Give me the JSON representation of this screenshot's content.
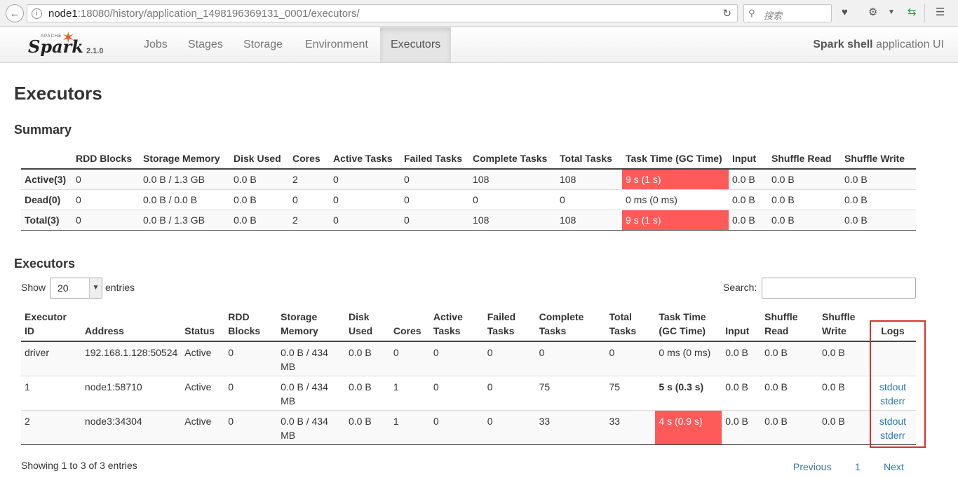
{
  "browser": {
    "url_host": "node1",
    "url_rest": ":18080/history/application_1498196369131_0001/executors/",
    "search_placeholder": "搜索"
  },
  "nav": {
    "brand_apache": "APACHE",
    "brand_spark": "Spark",
    "version": "2.1.0",
    "tabs": [
      "Jobs",
      "Stages",
      "Storage",
      "Environment",
      "Executors"
    ],
    "active_tab": "Executors",
    "app_title_bold": "Spark shell",
    "app_title_rest": " application UI"
  },
  "page_title": "Executors",
  "summary": {
    "heading": "Summary",
    "headers": [
      "",
      "RDD Blocks",
      "Storage Memory",
      "Disk Used",
      "Cores",
      "Active Tasks",
      "Failed Tasks",
      "Complete Tasks",
      "Total Tasks",
      "Task Time (GC Time)",
      "Input",
      "Shuffle Read",
      "Shuffle Write"
    ],
    "rows": [
      [
        "Active(3)",
        "0",
        "0.0 B / 1.3 GB",
        "0.0 B",
        "2",
        "0",
        "0",
        "108",
        "108",
        "9 s (1 s)",
        "0.0 B",
        "0.0 B",
        "0.0 B"
      ],
      [
        "Dead(0)",
        "0",
        "0.0 B / 0.0 B",
        "0.0 B",
        "0",
        "0",
        "0",
        "0",
        "0",
        "0 ms (0 ms)",
        "0.0 B",
        "0.0 B",
        "0.0 B"
      ],
      [
        "Total(3)",
        "0",
        "0.0 B / 1.3 GB",
        "0.0 B",
        "2",
        "0",
        "0",
        "108",
        "108",
        "9 s (1 s)",
        "0.0 B",
        "0.0 B",
        "0.0 B"
      ]
    ]
  },
  "executors": {
    "heading": "Executors",
    "show_label": "Show",
    "page_size": "20",
    "entries_label": "entries",
    "search_label": "Search:",
    "headers": [
      "Executor ID",
      "Address",
      "Status",
      "RDD Blocks",
      "Storage Memory",
      "Disk Used",
      "Cores",
      "Active Tasks",
      "Failed Tasks",
      "Complete Tasks",
      "Total Tasks",
      "Task Time (GC Time)",
      "Input",
      "Shuffle Read",
      "Shuffle Write",
      "Logs"
    ],
    "rows": [
      [
        "driver",
        "192.168.1.128:50524",
        "Active",
        "0",
        "0.0 B / 434 MB",
        "0.0 B",
        "0",
        "0",
        "0",
        "0",
        "0",
        "0 ms (0 ms)",
        "0.0 B",
        "0.0 B",
        "0.0 B"
      ],
      [
        "1",
        "node1:58710",
        "Active",
        "0",
        "0.0 B / 434 MB",
        "0.0 B",
        "1",
        "0",
        "0",
        "75",
        "75",
        "5 s (0.3 s)",
        "0.0 B",
        "0.0 B",
        "0.0 B"
      ],
      [
        "2",
        "node3:34304",
        "Active",
        "0",
        "0.0 B / 434 MB",
        "0.0 B",
        "1",
        "0",
        "0",
        "33",
        "33",
        "4 s (0.9 s)",
        "0.0 B",
        "0.0 B",
        "0.0 B"
      ]
    ],
    "logs": [
      [],
      [
        "stdout",
        "stderr"
      ],
      [
        "stdout",
        "stderr"
      ]
    ],
    "showing": "Showing 1 to 3 of 3 entries",
    "prev": "Previous",
    "page": "1",
    "next": "Next"
  },
  "colors": {
    "highlight_red": "#ff5a5a",
    "link": "#2a7ab0",
    "annotation_box": "#d9312e"
  }
}
